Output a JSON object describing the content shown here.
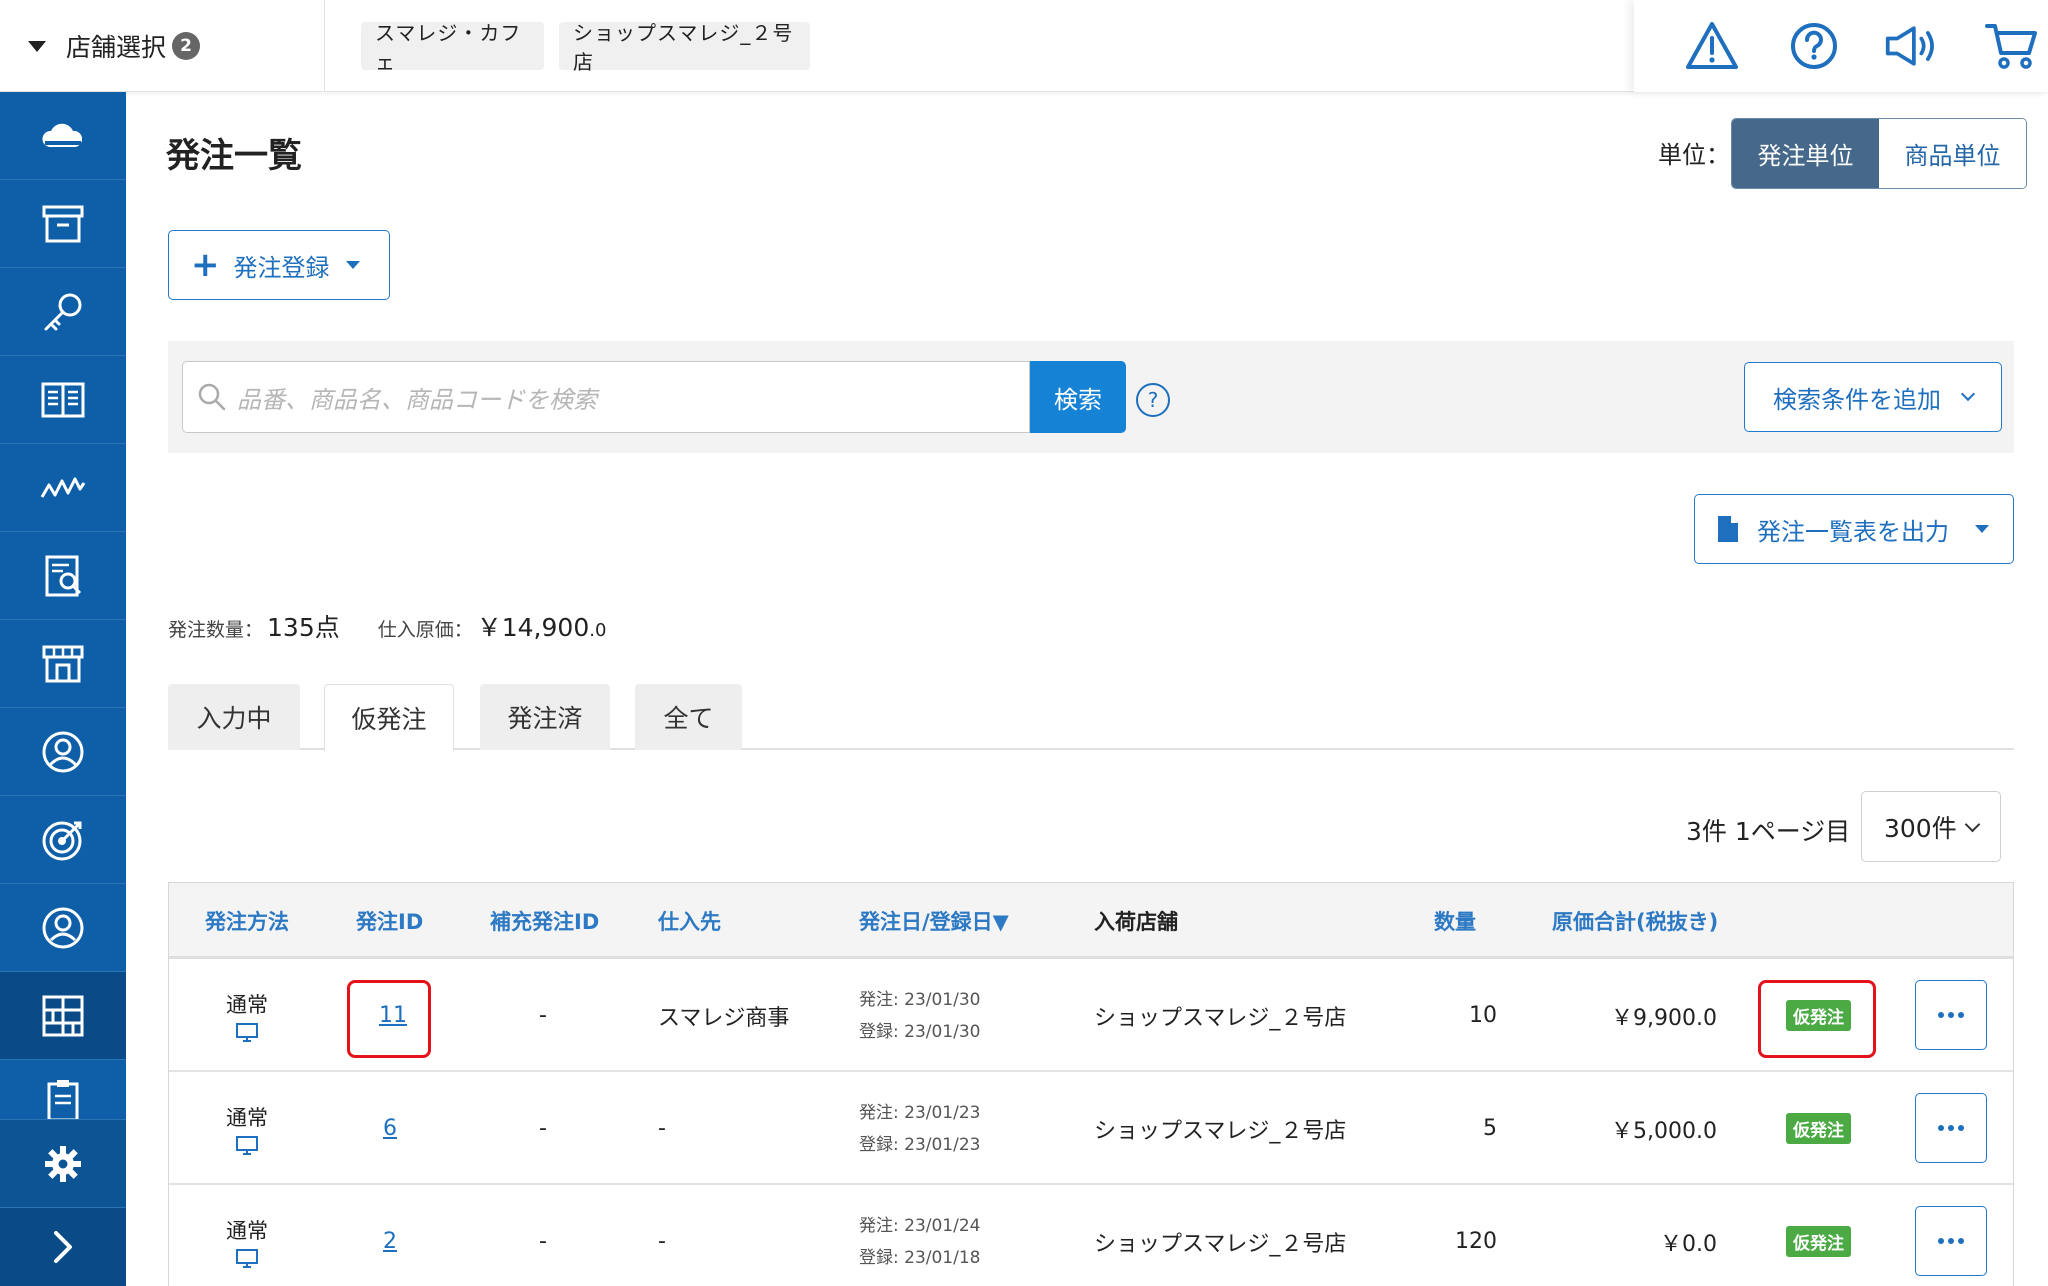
{
  "header": {
    "store_select_label": "店舗選択",
    "store_count": "2",
    "breadcrumbs": [
      "スマレジ・カフェ",
      "ショップスマレジ_２号店"
    ],
    "icons": [
      "warning-icon",
      "help-icon",
      "megaphone-icon",
      "cart-icon"
    ]
  },
  "sidebar": {
    "items": [
      "cloud-icon",
      "archive-box-icon",
      "key-icon",
      "book-icon",
      "analytics-icon",
      "report-icon",
      "store-icon",
      "user-icon",
      "target-icon",
      "person-icon",
      "grid-icon",
      "clipboard-icon"
    ],
    "active": "grid-icon",
    "bottom": [
      "gear-icon",
      "chevron-right-icon"
    ]
  },
  "page": {
    "title": "発注一覧",
    "unit_label": "単位：",
    "unit_options": [
      "発注単位",
      "商品単位"
    ],
    "unit_selected": "発注単位",
    "register_button": "発注登録",
    "search_placeholder": "品番、商品名、商品コードを検索",
    "search_button": "検索",
    "help_mark": "?",
    "add_condition_button": "検索条件を追加",
    "export_button": "発注一覧表を出力"
  },
  "summary": {
    "quantity_label": "発注数量：",
    "quantity_value": "135点",
    "cost_label": "仕入原価：",
    "cost_value": "￥14,900",
    "cost_decimal": ".0"
  },
  "tabs": [
    "入力中",
    "仮発注",
    "発注済",
    "全て"
  ],
  "active_tab": "仮発注",
  "pagination": {
    "text": "3件 1ページ目",
    "per_page": "300件"
  },
  "table": {
    "headers": [
      "発注方法",
      "発注ID",
      "補充発注ID",
      "仕入先",
      "発注日/登録日▼",
      "入荷店舗",
      "数量",
      "原価合計(税抜き)"
    ],
    "rows": [
      {
        "method": "通常",
        "id": "11",
        "replenish_id": "-",
        "supplier": "スマレジ商事",
        "order_date": "発注: 23/01/30",
        "reg_date": "登録: 23/01/30",
        "store": "ショップスマレジ_２号店",
        "qty": "10",
        "total": "￥9,900.0",
        "status": "仮発注"
      },
      {
        "method": "通常",
        "id": "6",
        "replenish_id": "-",
        "supplier": "-",
        "order_date": "発注: 23/01/23",
        "reg_date": "登録: 23/01/23",
        "store": "ショップスマレジ_２号店",
        "qty": "5",
        "total": "￥5,000.0",
        "status": "仮発注"
      },
      {
        "method": "通常",
        "id": "2",
        "replenish_id": "-",
        "supplier": "-",
        "order_date": "発注: 23/01/24",
        "reg_date": "登録: 23/01/18",
        "store": "ショップスマレジ_２号店",
        "qty": "120",
        "total": "￥0.0",
        "status": "仮発注"
      }
    ]
  },
  "colors": {
    "sidebar": "#0e5fa7",
    "accent": "#1682d6",
    "badge": "#4caa45",
    "highlight": "#e3121b"
  }
}
